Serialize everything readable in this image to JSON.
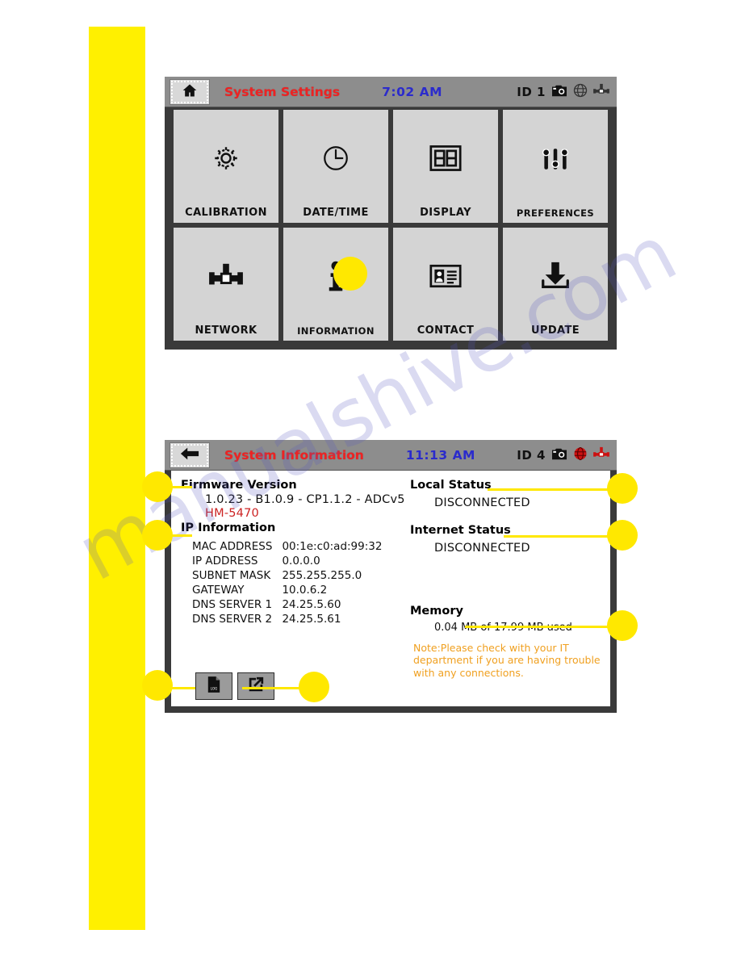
{
  "watermark": "manualshive.com",
  "screen_settings": {
    "titlebar": {
      "back_icon": "home-icon",
      "title": "System Settings",
      "clock": "7:02 AM",
      "id_label": "ID 1",
      "camera_icon": "camera-icon",
      "globe_icon": "globe-icon",
      "network_icon": "network-icon",
      "globe_color": "#333333",
      "network_color": "#333333"
    },
    "tiles": [
      {
        "label": "CALIBRATION",
        "icon": "gear-icon"
      },
      {
        "label": "DATE/TIME",
        "icon": "clock-icon"
      },
      {
        "label": "DISPLAY",
        "icon": "seven-segment-icon"
      },
      {
        "label": "PREFERENCES",
        "icon": "sliders-icon"
      },
      {
        "label": "NETWORK",
        "icon": "network-icon"
      },
      {
        "label": "INFORMATION",
        "icon": "info-icon"
      },
      {
        "label": "CONTACT",
        "icon": "contact-card-icon"
      },
      {
        "label": "UPDATE",
        "icon": "download-icon"
      }
    ]
  },
  "screen_info": {
    "titlebar": {
      "back_icon": "back-arrow-icon",
      "title": "System Information",
      "clock": "11:13 AM",
      "id_label": "ID 4",
      "camera_icon": "camera-icon",
      "globe_icon": "globe-icon",
      "network_icon": "network-icon",
      "globe_color": "#cc1111",
      "network_color": "#cc1111"
    },
    "firmware": {
      "heading": "Firmware Version",
      "version": "1.0.23 - B1.0.9 - CP1.1.2 - ADCv5",
      "model": "HM-5470"
    },
    "ip": {
      "heading": "IP Information",
      "rows": [
        {
          "key": "MAC ADDRESS",
          "value": "00:1e:c0:ad:99:32"
        },
        {
          "key": "IP ADDRESS",
          "value": "0.0.0.0"
        },
        {
          "key": "SUBNET MASK",
          "value": "255.255.255.0"
        },
        {
          "key": "GATEWAY",
          "value": "10.0.6.2"
        },
        {
          "key": "DNS SERVER 1",
          "value": "24.25.5.60"
        },
        {
          "key": "DNS SERVER 2",
          "value": "24.25.5.61"
        }
      ]
    },
    "local_status": {
      "heading": "Local Status",
      "value": "DISCONNECTED"
    },
    "internet_status": {
      "heading": "Internet Status",
      "value": "DISCONNECTED"
    },
    "memory": {
      "heading": "Memory",
      "value": "0.04 MB of 17.99 MB used"
    },
    "note": "Note:Please check with your IT department if you are having trouble with any connections.",
    "buttons": [
      {
        "icon": "log-file-icon"
      },
      {
        "icon": "external-link-icon"
      }
    ]
  },
  "colors": {
    "accent_yellow": "#ffe800",
    "sidebar_yellow": "#fff000",
    "title_red": "#ee2222",
    "clock_blue": "#2b2bcc",
    "note_orange": "#f0a020",
    "bezel": "#3a3a3a",
    "titlebar_grey": "#8d8d8d",
    "tile_grey": "#d4d4d4"
  }
}
